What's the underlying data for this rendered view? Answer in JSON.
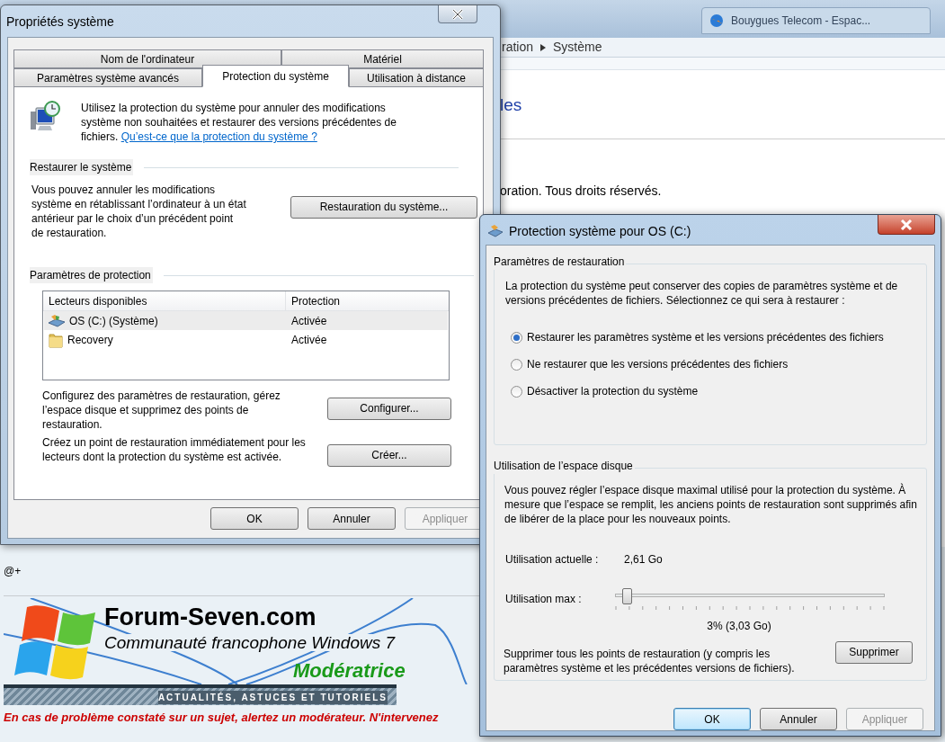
{
  "browser": {
    "tabs": [
      {
        "label": "Bouygues Telecom - Espac..."
      }
    ]
  },
  "background_page": {
    "breadcrumb": [
      "ration",
      "Système"
    ],
    "heading": "les",
    "copyright": "oration. Tous droits réservés."
  },
  "forum": {
    "signoff": "@+",
    "banner": {
      "title": "Forum-Seven.com",
      "subtitle": "Communauté francophone Windows 7",
      "role": "Modératrice",
      "strip": "ACTUALITÉS, ASTUCES ET TUTORIELS"
    },
    "notice": "En cas de problème constaté sur un sujet, alertez un modérateur. N'intervenez"
  },
  "system_properties": {
    "title": "Propriétés système",
    "tab_rows": [
      [
        {
          "label": "Nom de l'ordinateur",
          "selected": false
        },
        {
          "label": "Matériel",
          "selected": false
        }
      ],
      [
        {
          "label": "Paramètres système avancés",
          "selected": false
        },
        {
          "label": "Protection du système",
          "selected": true
        },
        {
          "label": "Utilisation à distance",
          "selected": false
        }
      ]
    ],
    "intro": "Utilisez la protection du système pour annuler des modifications système non souhaitées et restaurer des versions précédentes de fichiers.",
    "intro_link": "Qu’est-ce que la protection du système ?",
    "restore": {
      "heading": "Restaurer le système",
      "text": "Vous pouvez annuler les modifications système en rétablissant l’ordinateur à un état antérieur par le choix d’un précédent point de restauration.",
      "button": "Restauration du système..."
    },
    "protection": {
      "heading": "Paramètres de protection",
      "columns": [
        "Lecteurs disponibles",
        "Protection"
      ],
      "rows": [
        {
          "kind": "drive",
          "name": "OS (C:) (Système)",
          "status": "Activée",
          "selected": true
        },
        {
          "kind": "folder",
          "name": "Recovery",
          "status": "Activée",
          "selected": false
        }
      ],
      "configure": {
        "text": "Configurez des paramètres de restauration, gérez l’espace disque et supprimez des points de restauration.",
        "button": "Configurer..."
      },
      "create": {
        "text": "Créez un point de restauration immédiatement pour les lecteurs dont la protection du système est activée.",
        "button": "Créer..."
      }
    },
    "buttons": [
      {
        "label": "OK",
        "disabled": false
      },
      {
        "label": "Annuler",
        "disabled": false
      },
      {
        "label": "Appliquer",
        "disabled": true
      }
    ]
  },
  "protection_dialog": {
    "title": "Protection système pour OS (C:)",
    "restore_settings": {
      "heading": "Paramètres de restauration",
      "text": "La protection du système peut conserver des copies de paramètres système et de versions précédentes de fichiers. Sélectionnez ce qui sera à restaurer :",
      "options": [
        {
          "label": "Restaurer les paramètres système et les versions précédentes des fichiers",
          "selected": true
        },
        {
          "label": "Ne restaurer que les versions précédentes des fichiers",
          "selected": false
        },
        {
          "label": "Désactiver la protection du système",
          "selected": false
        }
      ]
    },
    "disk_usage": {
      "heading": "Utilisation de l’espace disque",
      "text": "Vous pouvez régler l’espace disque maximal utilisé pour la protection du système. À mesure que l’espace se remplit, les anciens points de restauration sont supprimés afin de libérer de la place pour les nouveaux points.",
      "current_label": "Utilisation actuelle :",
      "current_value": "2,61 Go",
      "max_label": "Utilisation max :",
      "max_slider": {
        "level": 0.04
      },
      "max_reading": "3% (3,03 Go)",
      "delete_text": "Supprimer tous les points de restauration (y compris les paramètres système et les précédentes versions de fichiers).",
      "delete_button": "Supprimer"
    },
    "buttons": [
      {
        "label": "OK",
        "disabled": false,
        "focused": true
      },
      {
        "label": "Annuler",
        "disabled": false,
        "focused": false
      },
      {
        "label": "Appliquer",
        "disabled": true,
        "focused": false
      }
    ]
  }
}
